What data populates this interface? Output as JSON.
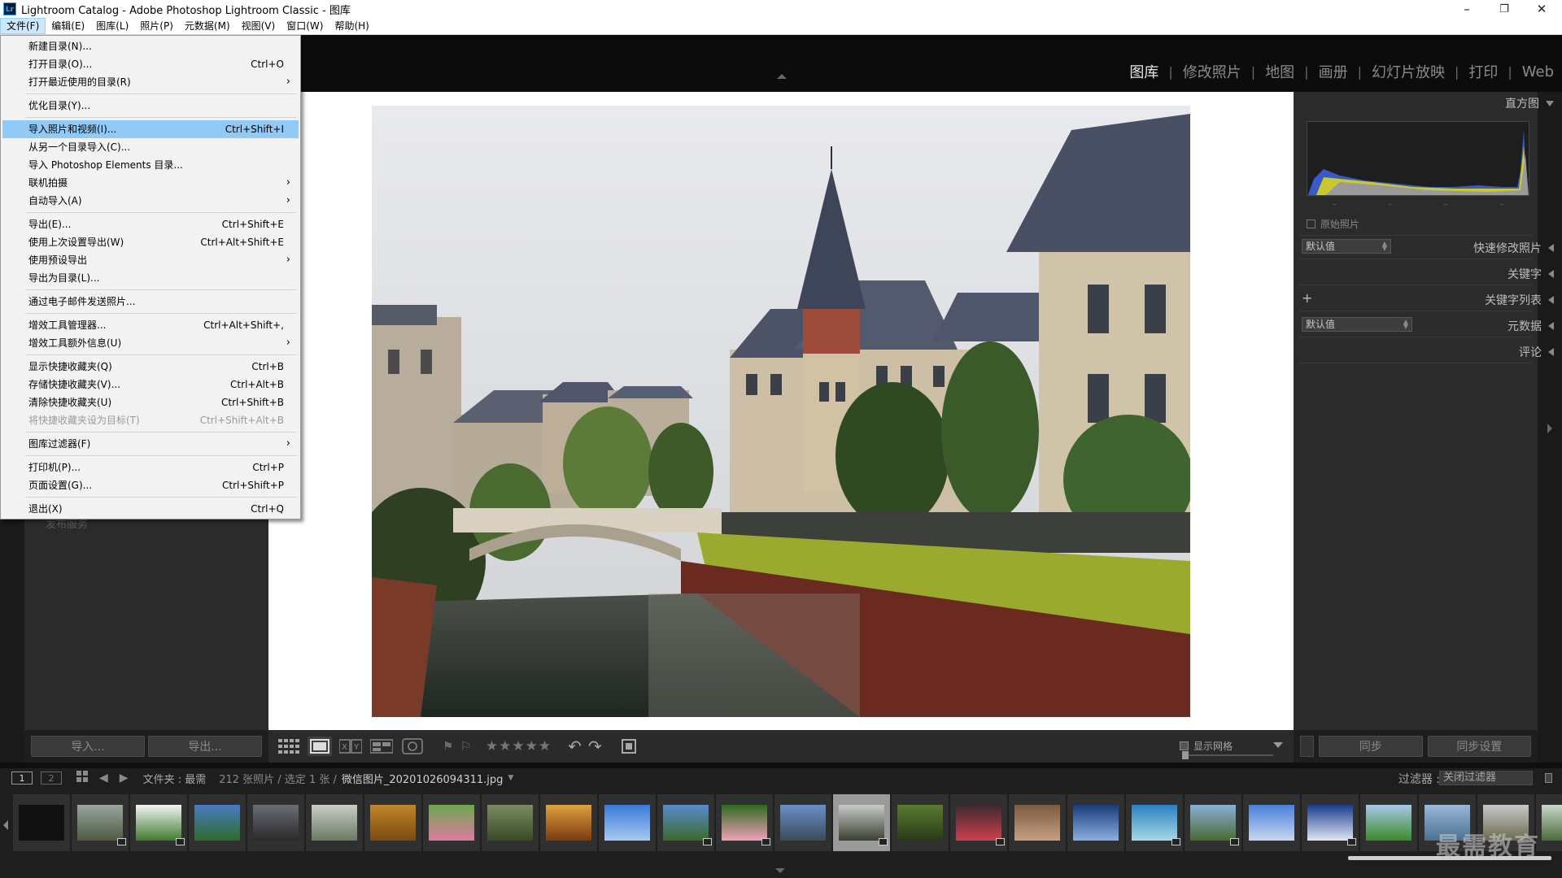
{
  "window": {
    "title": "Lightroom Catalog - Adobe Photoshop Lightroom Classic - 图库",
    "logo": "Lr",
    "controls": {
      "minimize": "–",
      "restore": "❐",
      "close": "✕"
    }
  },
  "menubar": [
    "文件(F)",
    "编辑(E)",
    "图库(L)",
    "照片(P)",
    "元数据(M)",
    "视图(V)",
    "窗口(W)",
    "帮助(H)"
  ],
  "modules": [
    "图库",
    "修改照片",
    "地图",
    "画册",
    "幻灯片放映",
    "打印",
    "Web"
  ],
  "file_menu": [
    {
      "label": "新建目录(N)...",
      "shortcut": ""
    },
    {
      "label": "打开目录(O)...",
      "shortcut": "Ctrl+O"
    },
    {
      "label": "打开最近使用的目录(R)",
      "shortcut": "",
      "submenu": true
    },
    {
      "label": "优化目录(Y)...",
      "shortcut": ""
    },
    {
      "label": "导入照片和视频(I)...",
      "shortcut": "Ctrl+Shift+I",
      "highlighted": true
    },
    {
      "label": "从另一个目录导入(C)...",
      "shortcut": ""
    },
    {
      "label": "导入 Photoshop Elements 目录...",
      "shortcut": ""
    },
    {
      "label": "联机拍摄",
      "shortcut": "",
      "submenu": true
    },
    {
      "label": "自动导入(A)",
      "shortcut": "",
      "submenu": true
    },
    {
      "label": "导出(E)...",
      "shortcut": "Ctrl+Shift+E"
    },
    {
      "label": "使用上次设置导出(W)",
      "shortcut": "Ctrl+Alt+Shift+E"
    },
    {
      "label": "使用预设导出",
      "shortcut": "",
      "submenu": true
    },
    {
      "label": "导出为目录(L)...",
      "shortcut": ""
    },
    {
      "label": "通过电子邮件发送照片...",
      "shortcut": ""
    },
    {
      "label": "增效工具管理器...",
      "shortcut": "Ctrl+Alt+Shift+,"
    },
    {
      "label": "增效工具额外信息(U)",
      "shortcut": "",
      "submenu": true
    },
    {
      "label": "显示快捷收藏夹(Q)",
      "shortcut": "Ctrl+B"
    },
    {
      "label": "存储快捷收藏夹(V)...",
      "shortcut": "Ctrl+Alt+B"
    },
    {
      "label": "清除快捷收藏夹(U)",
      "shortcut": "Ctrl+Shift+B"
    },
    {
      "label": "将快捷收藏夹设为目标(T)",
      "shortcut": "Ctrl+Shift+Alt+B",
      "disabled": true
    },
    {
      "label": "图库过滤器(F)",
      "shortcut": "",
      "submenu": true
    },
    {
      "label": "打印机(P)...",
      "shortcut": "Ctrl+P"
    },
    {
      "label": "页面设置(G)...",
      "shortcut": "Ctrl+Shift+P"
    },
    {
      "label": "退出(X)",
      "shortcut": "Ctrl+Q"
    }
  ],
  "left_panel": {
    "publish_hint": "发布服务",
    "import_button": "导入...",
    "export_button": "导出..."
  },
  "right_panel": {
    "histogram": "直方图",
    "original_photo": "原始照片",
    "quick_develop": "快速修改照片",
    "quick_develop_preset": "默认值",
    "keywording": "关键字",
    "keyword_list": "关键字列表",
    "metadata": "元数据",
    "metadata_preset": "默认值",
    "comments": "评论",
    "sync_button": "同步",
    "sync_settings_button": "同步设置",
    "hist_ticks": [
      "–",
      "–",
      "–",
      "–"
    ]
  },
  "toolbar": {
    "stars": "★★★★★",
    "show_grid": "显示网格"
  },
  "filmstrip_header": {
    "screen1": "1",
    "screen2": "2",
    "source": "文件夹 : 最需",
    "count": "212 张照片 / 选定 1 张 /",
    "filename": "微信图片_20201026094311.jpg",
    "filter_label": "过滤器 :",
    "filter_value": "关闭过滤器"
  },
  "filmstrip": {
    "thumbnails": [
      {
        "colors": [
          "#111111",
          "#111111"
        ]
      },
      {
        "colors": [
          "#9aa5a0",
          "#4d5a40"
        ],
        "badge": true
      },
      {
        "colors": [
          "#f4f4f4",
          "#3f7a2e"
        ],
        "badge": true
      },
      {
        "colors": [
          "#4a7bc4",
          "#2f6a2a"
        ]
      },
      {
        "colors": [
          "#6a6d78",
          "#2a2a2a"
        ]
      },
      {
        "colors": [
          "#c9ccc8",
          "#6a7a60"
        ]
      },
      {
        "colors": [
          "#c2852a",
          "#7a4a10"
        ]
      },
      {
        "colors": [
          "#6aa84f",
          "#e07aa0"
        ]
      },
      {
        "colors": [
          "#7a8a60",
          "#3a4a28"
        ]
      },
      {
        "colors": [
          "#e0a040",
          "#7a3a10"
        ]
      },
      {
        "colors": [
          "#3a7ad8",
          "#a8c8f0"
        ]
      },
      {
        "colors": [
          "#5a8ad0",
          "#3a6a28"
        ],
        "badge": true
      },
      {
        "colors": [
          "#2e6a20",
          "#f0a0b8"
        ],
        "badge": true
      },
      {
        "colors": [
          "#6a90c8",
          "#3a4a5a"
        ]
      },
      {
        "colors": [
          "#c8cac8",
          "#3a4030"
        ],
        "badge": true,
        "current": true
      },
      {
        "colors": [
          "#5a7a30",
          "#2a3a18"
        ]
      },
      {
        "colors": [
          "#3a2a30",
          "#d04050"
        ],
        "badge": true
      },
      {
        "colors": [
          "#7a5a40",
          "#c8a080"
        ]
      },
      {
        "colors": [
          "#1a3a7a",
          "#8ab0e0"
        ]
      },
      {
        "colors": [
          "#2a80c0",
          "#a8d8e8"
        ],
        "badge": true
      },
      {
        "colors": [
          "#8ab0d8",
          "#4a6a30"
        ],
        "badge": true
      },
      {
        "colors": [
          "#4a80d8",
          "#c8d8f0"
        ]
      },
      {
        "colors": [
          "#1a3a8a",
          "#dfe8f8"
        ],
        "badge": true
      },
      {
        "colors": [
          "#a8c8e8",
          "#3a8a2a"
        ]
      },
      {
        "colors": [
          "#9ab8d8",
          "#4a7090"
        ]
      },
      {
        "colors": [
          "#c8c8c8",
          "#6a6a50"
        ]
      },
      {
        "colors": [
          "#c8d8c8",
          "#4a6a3a"
        ]
      }
    ]
  },
  "watermark": "最需教育"
}
